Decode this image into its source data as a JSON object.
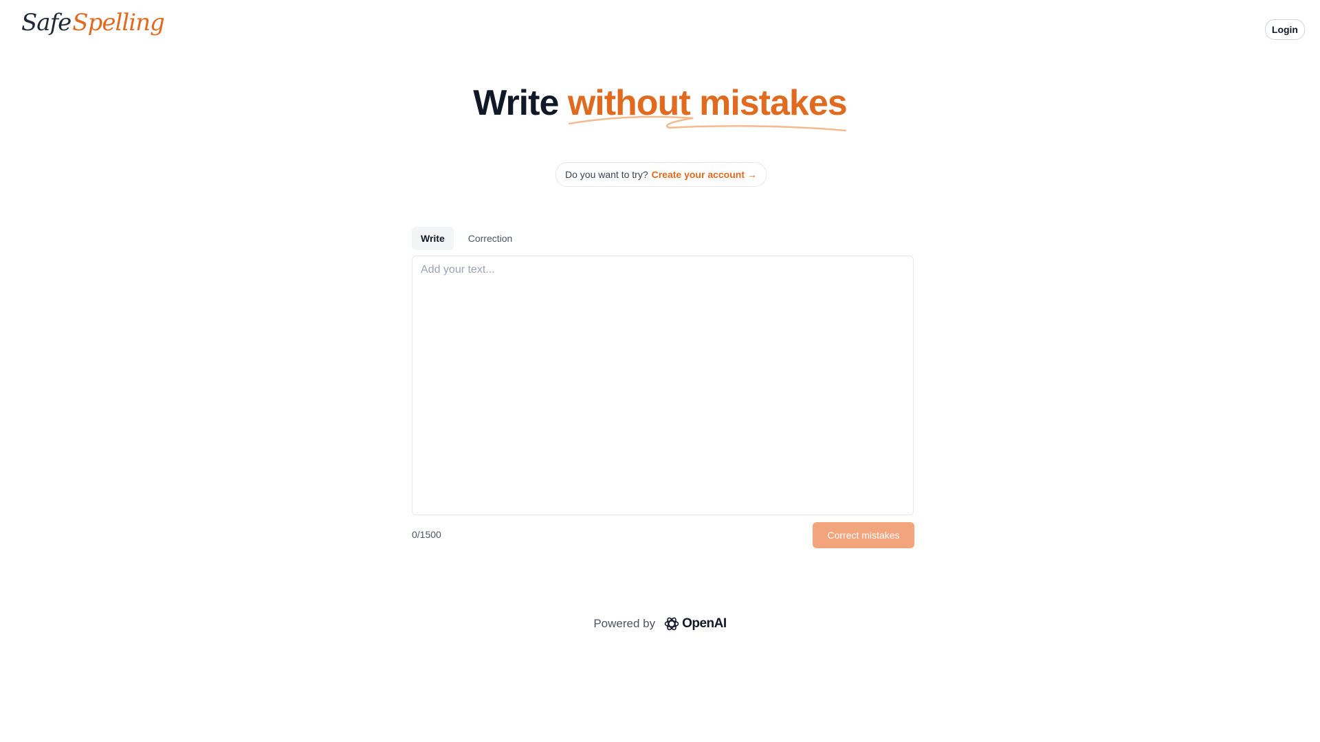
{
  "header": {
    "logo_part1": "Safe",
    "logo_part2": "Spelling",
    "login_label": "Login"
  },
  "hero": {
    "title_plain": "Write",
    "title_accent": "without mistakes"
  },
  "try_banner": {
    "question": "Do you want to try?",
    "link_label": "Create your account →"
  },
  "tabs": [
    {
      "label": "Write",
      "active": true
    },
    {
      "label": "Correction",
      "active": false
    }
  ],
  "editor": {
    "placeholder": "Add your text...",
    "value": ""
  },
  "counter": "0/1500",
  "submit_label": "Correct mistakes",
  "footer": {
    "powered_by": "Powered by",
    "brand": "OpenAI",
    "brand_icon": "openai-logo-icon"
  },
  "colors": {
    "accent": "#e06a1f",
    "button_disabled": "#f2a57c",
    "text_dark": "#111827"
  }
}
